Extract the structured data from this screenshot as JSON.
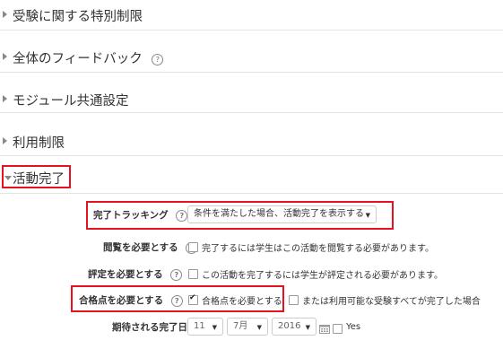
{
  "sections": [
    {
      "title": "受験に関する特別制限",
      "has_help": false
    },
    {
      "title": "全体のフィードバック",
      "has_help": true
    },
    {
      "title": "モジュール共通設定",
      "has_help": false
    },
    {
      "title": "利用制限",
      "has_help": false
    }
  ],
  "completion": {
    "title": "活動完了",
    "tracking_label": "完了トラッキング",
    "tracking_value": "条件を満たした場合、活動完了を表示する",
    "view_label": "閲覧を必要とする",
    "view_text": "完了するには学生はこの活動を閲覧する必要があります。",
    "grade_label": "評定を必要とする",
    "grade_text": "この活動を完了するには学生が評定される必要があります。",
    "pass_label": "合格点を必要とする",
    "pass_text": "合格点を必要とする",
    "pass_or_text": "または利用可能な受験すべてが完了した場合",
    "expected_label": "期待される完了日",
    "day": "11",
    "month": "7月",
    "year": "2016",
    "yes_label": "Yes",
    "help_glyph": "?",
    "caret_glyph": "▼"
  },
  "colors": {
    "highlight": "#e8121e"
  }
}
